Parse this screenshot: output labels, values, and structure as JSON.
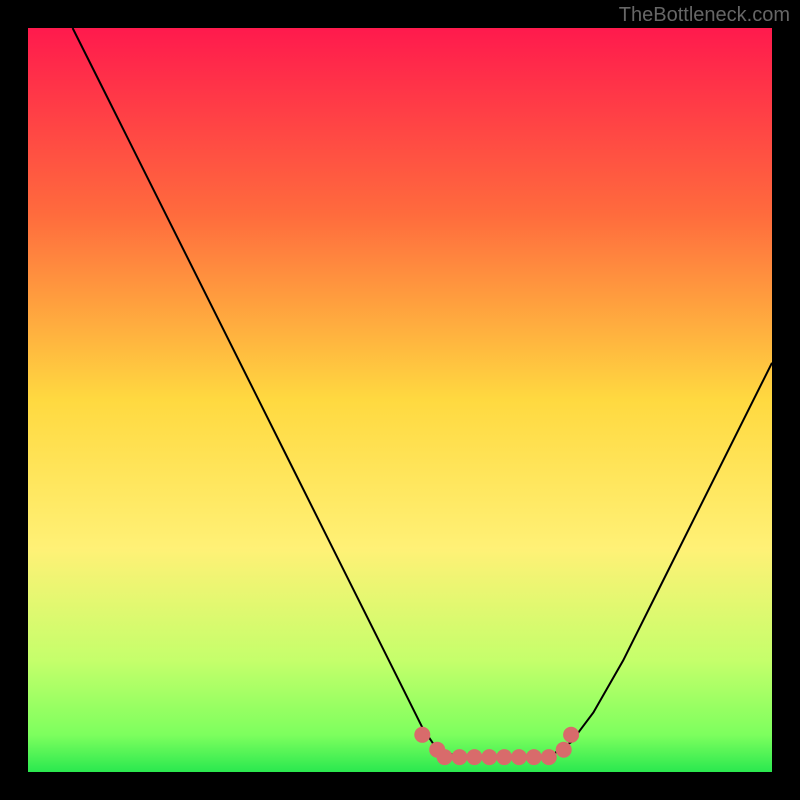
{
  "watermark": "TheBottleneck.com",
  "chart_data": {
    "type": "line",
    "title": "",
    "xlabel": "",
    "ylabel": "",
    "xlim": [
      0,
      100
    ],
    "ylim": [
      0,
      100
    ],
    "background_gradient": {
      "stops": [
        {
          "offset": 0,
          "color": "#ff1a4d"
        },
        {
          "offset": 25,
          "color": "#ff6b3d"
        },
        {
          "offset": 50,
          "color": "#ffd940"
        },
        {
          "offset": 70,
          "color": "#fff176"
        },
        {
          "offset": 85,
          "color": "#c5ff6b"
        },
        {
          "offset": 95,
          "color": "#7dff5e"
        },
        {
          "offset": 100,
          "color": "#2ae84f"
        }
      ]
    },
    "series": [
      {
        "name": "bottleneck-curve",
        "color": "#000000",
        "width": 2,
        "points": [
          {
            "x": 6,
            "y": 100
          },
          {
            "x": 10,
            "y": 92
          },
          {
            "x": 15,
            "y": 82
          },
          {
            "x": 20,
            "y": 72
          },
          {
            "x": 25,
            "y": 62
          },
          {
            "x": 30,
            "y": 52
          },
          {
            "x": 35,
            "y": 42
          },
          {
            "x": 40,
            "y": 32
          },
          {
            "x": 45,
            "y": 22
          },
          {
            "x": 50,
            "y": 12
          },
          {
            "x": 53,
            "y": 6
          },
          {
            "x": 55,
            "y": 3
          },
          {
            "x": 58,
            "y": 2
          },
          {
            "x": 62,
            "y": 2
          },
          {
            "x": 66,
            "y": 2
          },
          {
            "x": 70,
            "y": 2
          },
          {
            "x": 73,
            "y": 4
          },
          {
            "x": 76,
            "y": 8
          },
          {
            "x": 80,
            "y": 15
          },
          {
            "x": 85,
            "y": 25
          },
          {
            "x": 90,
            "y": 35
          },
          {
            "x": 95,
            "y": 45
          },
          {
            "x": 100,
            "y": 55
          }
        ]
      }
    ],
    "markers": [
      {
        "x": 53,
        "y": 5,
        "color": "#d86b6b",
        "size": 8
      },
      {
        "x": 55,
        "y": 3,
        "color": "#d86b6b",
        "size": 8
      },
      {
        "x": 56,
        "y": 2,
        "color": "#d86b6b",
        "size": 8
      },
      {
        "x": 58,
        "y": 2,
        "color": "#d86b6b",
        "size": 8
      },
      {
        "x": 60,
        "y": 2,
        "color": "#d86b6b",
        "size": 8
      },
      {
        "x": 62,
        "y": 2,
        "color": "#d86b6b",
        "size": 8
      },
      {
        "x": 64,
        "y": 2,
        "color": "#d86b6b",
        "size": 8
      },
      {
        "x": 66,
        "y": 2,
        "color": "#d86b6b",
        "size": 8
      },
      {
        "x": 68,
        "y": 2,
        "color": "#d86b6b",
        "size": 8
      },
      {
        "x": 70,
        "y": 2,
        "color": "#d86b6b",
        "size": 8
      },
      {
        "x": 72,
        "y": 3,
        "color": "#d86b6b",
        "size": 8
      },
      {
        "x": 73,
        "y": 5,
        "color": "#d86b6b",
        "size": 8
      }
    ]
  }
}
